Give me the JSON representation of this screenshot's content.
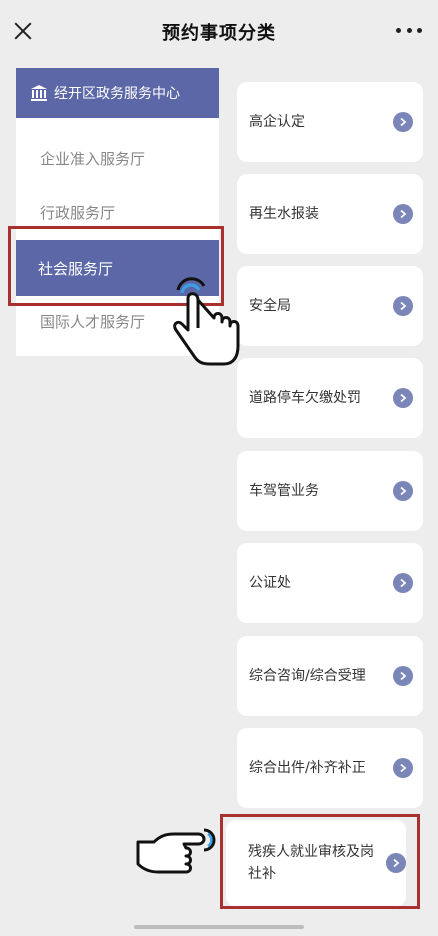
{
  "header": {
    "title": "预约事项分类",
    "close_icon": "close-icon",
    "more_icon": "more-icon"
  },
  "sidebar": {
    "header_label": "经开区政务服务中心",
    "header_icon": "bank-icon",
    "items": [
      {
        "label": "企业准入服务厅",
        "selected": false
      },
      {
        "label": "行政服务厅",
        "selected": false
      },
      {
        "label": "社会服务厅",
        "selected": true
      },
      {
        "label": "国际人才服务厅",
        "selected": false
      }
    ]
  },
  "services": [
    "高企认定",
    "再生水报装",
    "安全局",
    "道路停车欠缴处罚",
    "车驾管业务",
    "公证处",
    "综合咨询/综合受理",
    "综合出件/补齐补正",
    "残疾人就业审核及岗社补"
  ],
  "colors": {
    "accent": "#5c67a8",
    "chevron": "#7b86b8",
    "highlight": "#a8312f",
    "background": "#ededed"
  }
}
